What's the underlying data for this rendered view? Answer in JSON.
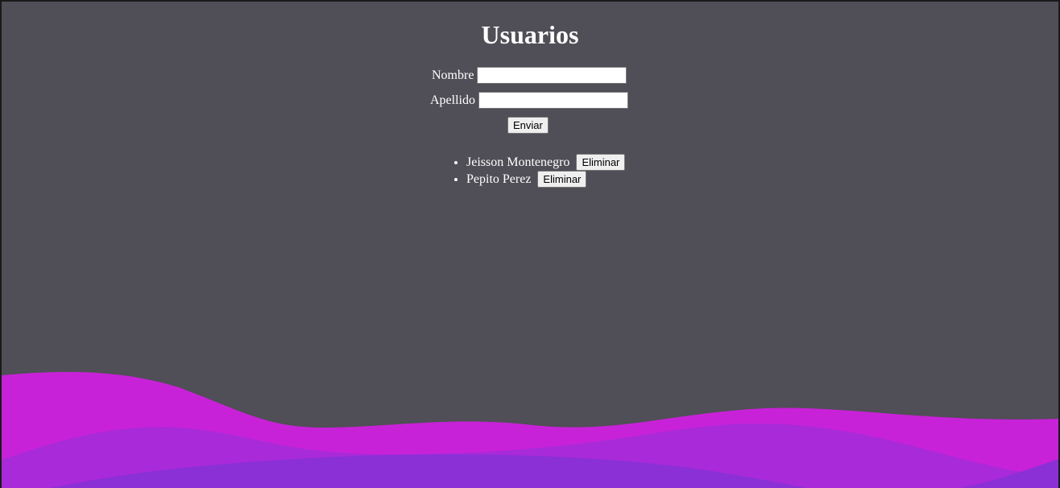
{
  "page": {
    "title": "Usuarios"
  },
  "form": {
    "nombre_label": "Nombre",
    "nombre_value": "",
    "apellido_label": "Apellido",
    "apellido_value": "",
    "submit_label": "Enviar"
  },
  "users": [
    {
      "name": "Jeisson Montenegro",
      "delete_label": "Eliminar"
    },
    {
      "name": "Pepito Perez",
      "delete_label": "Eliminar"
    }
  ],
  "colors": {
    "background": "#504e56",
    "wave_front": "#c822d8",
    "wave_mid": "#a92ad8",
    "wave_back": "#8a30d6"
  }
}
